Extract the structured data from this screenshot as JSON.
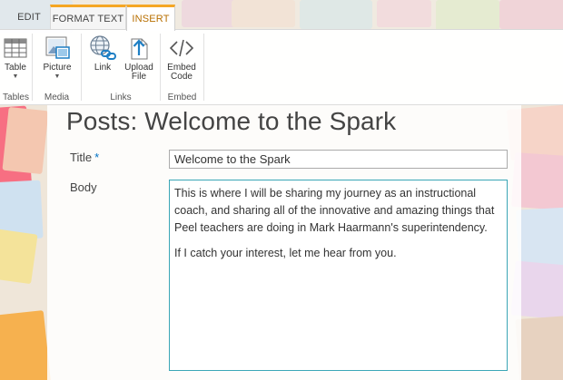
{
  "tabs": [
    {
      "label": "EDIT"
    },
    {
      "label": "FORMAT TEXT"
    },
    {
      "label": "INSERT",
      "active": true
    }
  ],
  "ribbon": {
    "groups": [
      {
        "label": "Tables",
        "buttons": [
          {
            "label": "Table",
            "icon": "table-icon",
            "dropdown": true
          }
        ]
      },
      {
        "label": "Media",
        "buttons": [
          {
            "label": "Picture",
            "icon": "picture-icon",
            "dropdown": true
          }
        ]
      },
      {
        "label": "Links",
        "buttons": [
          {
            "label": "Link",
            "icon": "link-icon"
          },
          {
            "label": "Upload\nFile",
            "icon": "upload-file-icon"
          }
        ]
      },
      {
        "label": "Embed",
        "buttons": [
          {
            "label": "Embed\nCode",
            "icon": "embed-code-icon"
          }
        ]
      }
    ]
  },
  "page": {
    "title": "Posts: Welcome to the Spark",
    "fields": {
      "title_label": "Title",
      "required_marker": "*",
      "title_value": "Welcome to the Spark",
      "body_label": "Body",
      "body_paragraphs": [
        "This is where I will be sharing my journey as an instructional coach, and sharing all of the innovative and amazing things that Peel teachers are doing in Mark Haarmann's superintendency.",
        "If I catch your interest, let me hear from you."
      ]
    }
  },
  "colors": {
    "tab_accent": "#f5a623",
    "active_tab_text": "#b86f00",
    "required_star": "#0072c6",
    "editor_border": "#3aa6b6"
  }
}
